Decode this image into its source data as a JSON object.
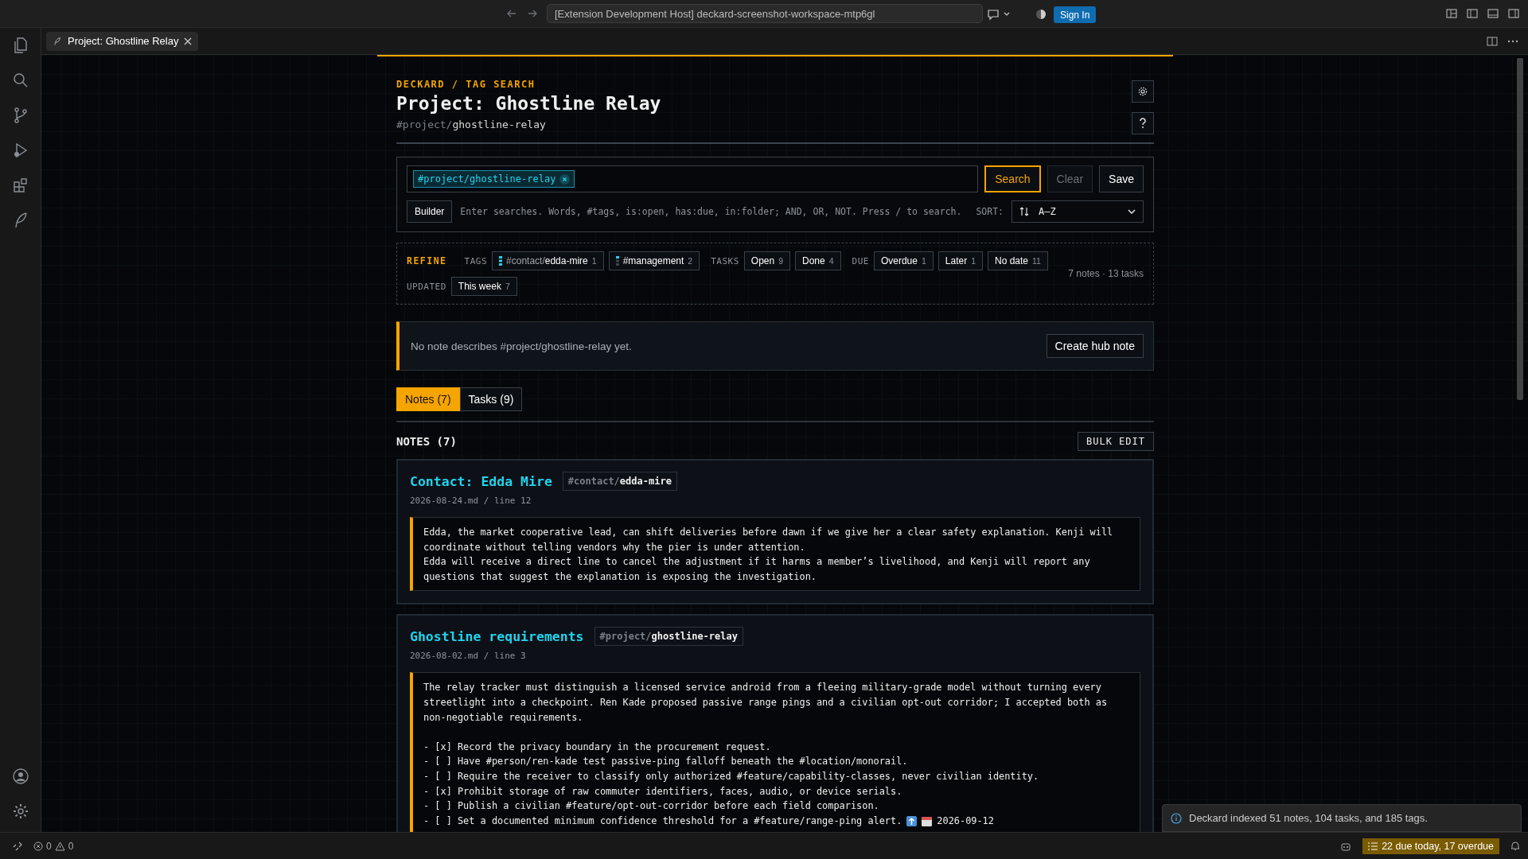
{
  "title_bar": {
    "title": "[Extension Development Host] deckard-screenshot-workspace-mtp6gl",
    "sign_in": "Sign In"
  },
  "editor_tab": {
    "label": "Project: Ghostline Relay"
  },
  "header": {
    "breadcrumb": "DECKARD / TAG SEARCH",
    "title": "Project: Ghostline Relay",
    "tag_prefix": "#project/",
    "tag_name": "ghostline-relay"
  },
  "search": {
    "chips": [
      {
        "label": "#project/ghostline-relay"
      }
    ],
    "buttons": [
      {
        "label": "Search",
        "kind": "primary"
      },
      {
        "label": "Clear",
        "kind": "disabled"
      },
      {
        "label": "Save",
        "kind": "normal"
      }
    ],
    "builder": "Builder",
    "placeholder": "Enter searches. Words, #tags, is:open, has:due, in:folder; AND, OR, NOT. Press / to search.",
    "sort_label": "SORT:",
    "sort_value": "A–Z"
  },
  "refine": {
    "label": "REFINE",
    "summary": "7 notes · 13 tasks",
    "rows": [
      {
        "groups": [
          {
            "label": "TAGS",
            "chips": [
              {
                "prefix": "#contact/",
                "name": "edda-mire",
                "count": "1",
                "kind": "full"
              },
              {
                "name": "#management",
                "count": "2",
                "kind": "partial"
              }
            ]
          },
          {
            "label": "TASKS",
            "chips": [
              {
                "name": "Open",
                "count": "9"
              },
              {
                "name": "Done",
                "count": "4"
              }
            ]
          },
          {
            "label": "DUE",
            "chips": [
              {
                "name": "Overdue",
                "count": "1"
              },
              {
                "name": "Later",
                "count": "1"
              },
              {
                "name": "No date",
                "count": "11"
              }
            ]
          }
        ]
      },
      {
        "groups": [
          {
            "label": "UPDATED",
            "chips": [
              {
                "name": "This week",
                "count": "7"
              }
            ]
          }
        ]
      }
    ]
  },
  "notice": {
    "text": "No note describes #project/ghostline-relay yet.",
    "button": "Create hub note"
  },
  "tabs": [
    {
      "label": "Notes (7)",
      "selected": true
    },
    {
      "label": "Tasks (9)",
      "selected": false
    }
  ],
  "notes_heading": "NOTES (7)",
  "bulk_edit": "BULK EDIT",
  "notes": [
    {
      "title": "Contact: Edda Mire",
      "tag_prefix": "#contact/",
      "tag_name": "edda-mire",
      "meta": "2026-08-24.md / line 12",
      "blocks": [
        {
          "kind": "paragraph",
          "lines": [
            "Edda, the market cooperative lead, can shift deliveries before dawn if we give her a clear safety explanation. Kenji will coordinate without telling vendors why the pier is under attention.",
            "Edda will receive a direct line to cancel the adjustment if it harms a member’s livelihood, and Kenji will report any questions that suggest the explanation is exposing the investigation."
          ]
        }
      ]
    },
    {
      "title": "Ghostline requirements",
      "tag_prefix": "#project/",
      "tag_name": "ghostline-relay",
      "meta": "2026-08-02.md / line 3",
      "blocks": [
        {
          "kind": "paragraph",
          "lines": [
            "The relay tracker must distinguish a licensed service android from a fleeing military-grade model without turning every streetlight into a checkpoint. Ren Kade proposed passive range pings and a civilian opt-out corridor; I accepted both as non-negotiable requirements."
          ]
        },
        {
          "kind": "tasks",
          "items": [
            {
              "text": "- [x] Record the privacy boundary in the procurement request."
            },
            {
              "text": "- [ ] Have #person/ren-kade test passive-ping falloff beneath the #location/monorail."
            },
            {
              "text": "- [ ] Require the receiver to classify only authorized #feature/capability-classes, never civilian identity."
            },
            {
              "text": "- [x] Prohibit storage of raw commuter identifiers, faces, audio, or device serials."
            },
            {
              "text": "- [ ] Publish a civilian #feature/opt-out-corridor before each field comparison."
            },
            {
              "text": "- [ ] Set a documented minimum confidence threshold for a #feature/range-ping alert.",
              "high_priority": true,
              "due": "2026-09-12"
            }
          ]
        }
      ]
    }
  ],
  "toast": {
    "text": "Deckard indexed 51 notes, 104 tasks, and 185 tags."
  },
  "status_bar": {
    "errors": "0",
    "warnings": "0",
    "due_badge": "22 due today, 17 overdue"
  }
}
